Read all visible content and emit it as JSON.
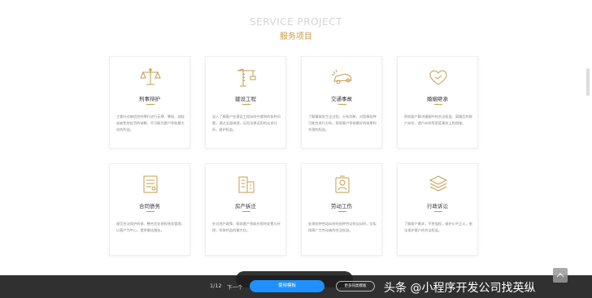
{
  "header": {
    "en": "SERVICE PROJECT",
    "cn": "服务项目"
  },
  "accent": "#c69c4b",
  "cards": [
    {
      "icon": "scales-icon",
      "title": "刑事辩护",
      "desc": "主要针对被侦控的罪行进行无罪、罪轻、减轻或者免除处罚的辩解，尽可能为客户争取最大化的利益。"
    },
    {
      "icon": "crane-icon",
      "title": "建设工程",
      "desc": "深入了解客户在建设工程纠纷中遇到的各种问题，通过全面梳理，运用法律适用的论述分析，维护权益。"
    },
    {
      "icon": "car-crash-icon",
      "title": "交通事故",
      "desc": "了解事故发生全过程，分析判断，对案情各种可能性进行分析，帮助客户争取最好的结果和合理的权益。"
    },
    {
      "icon": "heart-hands-icon",
      "title": "婚姻继承",
      "desc": "帮助客户解决婚姻中的合法权益、离婚后的财产纠纷、遗产纠纷等家庭事务上的困难。"
    },
    {
      "icon": "contract-icon",
      "title": "合同债务",
      "desc": "规范合法保护的债、整合优化债权债务管理，以客户为中心，提供最佳服务。"
    },
    {
      "icon": "building-icon",
      "title": "房产拆迁",
      "desc": "针对地产政策、帮助客户争取应得的安置与补偿，争取利益的最大化。"
    },
    {
      "icon": "worker-icon",
      "title": "劳动工伤",
      "desc": "处理各种劳动纠纷的各种劳动争议纠纷，切实保障广大劳动者的合法权益。"
    },
    {
      "icon": "layers-icon",
      "title": "行政诉讼",
      "desc": "了解客户需求，不畏强权，维护公平正义，依法保护客户的合法权益。"
    }
  ],
  "bottom": {
    "pager": "1/12",
    "next": "下一个",
    "use": "使用模板",
    "more": "更多同类模板",
    "watermark": "头条 @小程序开发公司找英纵"
  }
}
